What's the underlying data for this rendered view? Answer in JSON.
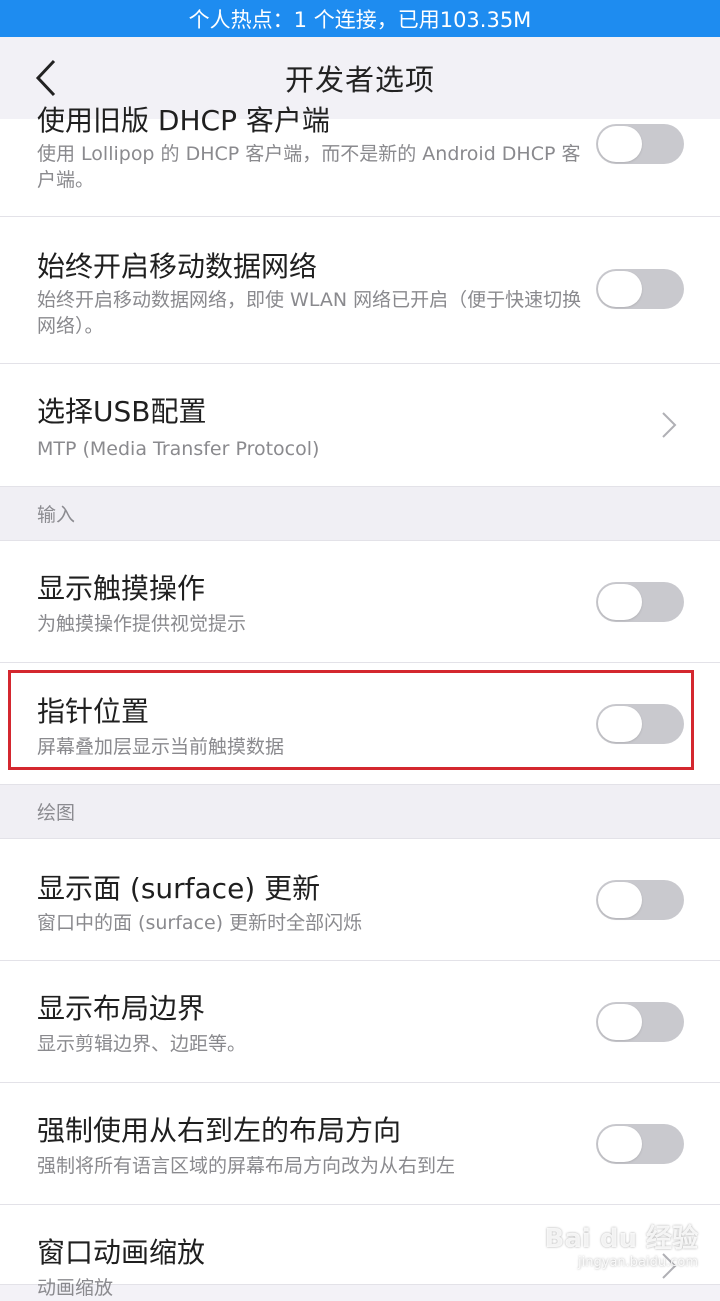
{
  "status_bar": {
    "text": "个人热点：1 个连接，已用103.35M"
  },
  "app_bar": {
    "title": "开发者选项",
    "back_icon": "chevron-left-icon"
  },
  "rows": [
    {
      "title": "使用旧版 DHCP 客户端",
      "subtitle": "使用 Lollipop 的 DHCP 客户端，而不是新的 Android DHCP 客户端。",
      "control": "toggle",
      "on": false
    },
    {
      "title": "始终开启移动数据网络",
      "subtitle": "始终开启移动数据网络，即使 WLAN 网络已开启（便于快速切换网络）。",
      "control": "toggle",
      "on": false
    },
    {
      "title": "选择USB配置",
      "subtitle": "MTP (Media Transfer Protocol)",
      "control": "chevron"
    },
    {
      "section": "输入"
    },
    {
      "title": "显示触摸操作",
      "subtitle": "为触摸操作提供视觉提示",
      "control": "toggle",
      "on": false
    },
    {
      "title": "指针位置",
      "subtitle": "屏幕叠加层显示当前触摸数据",
      "control": "toggle",
      "on": false,
      "highlighted": true
    },
    {
      "section": "绘图"
    },
    {
      "title": "显示面 (surface) 更新",
      "subtitle": "窗口中的面 (surface) 更新时全部闪烁",
      "control": "toggle",
      "on": false
    },
    {
      "title": "显示布局边界",
      "subtitle": "显示剪辑边界、边距等。",
      "control": "toggle",
      "on": false
    },
    {
      "title": "强制使用从右到左的布局方向",
      "subtitle": "强制将所有语言区域的屏幕布局方向改为从右到左",
      "control": "toggle",
      "on": false
    },
    {
      "title": "窗口动画缩放",
      "subtitle": "动画缩放",
      "control": "chevron"
    }
  ],
  "watermark": {
    "main": "Bai du 经验",
    "sub": "jingyan.baidu.com"
  },
  "colors": {
    "status_bar": "#1e8cf0",
    "highlight": "#d4272f",
    "toggle_off": "#c9c9ce"
  }
}
